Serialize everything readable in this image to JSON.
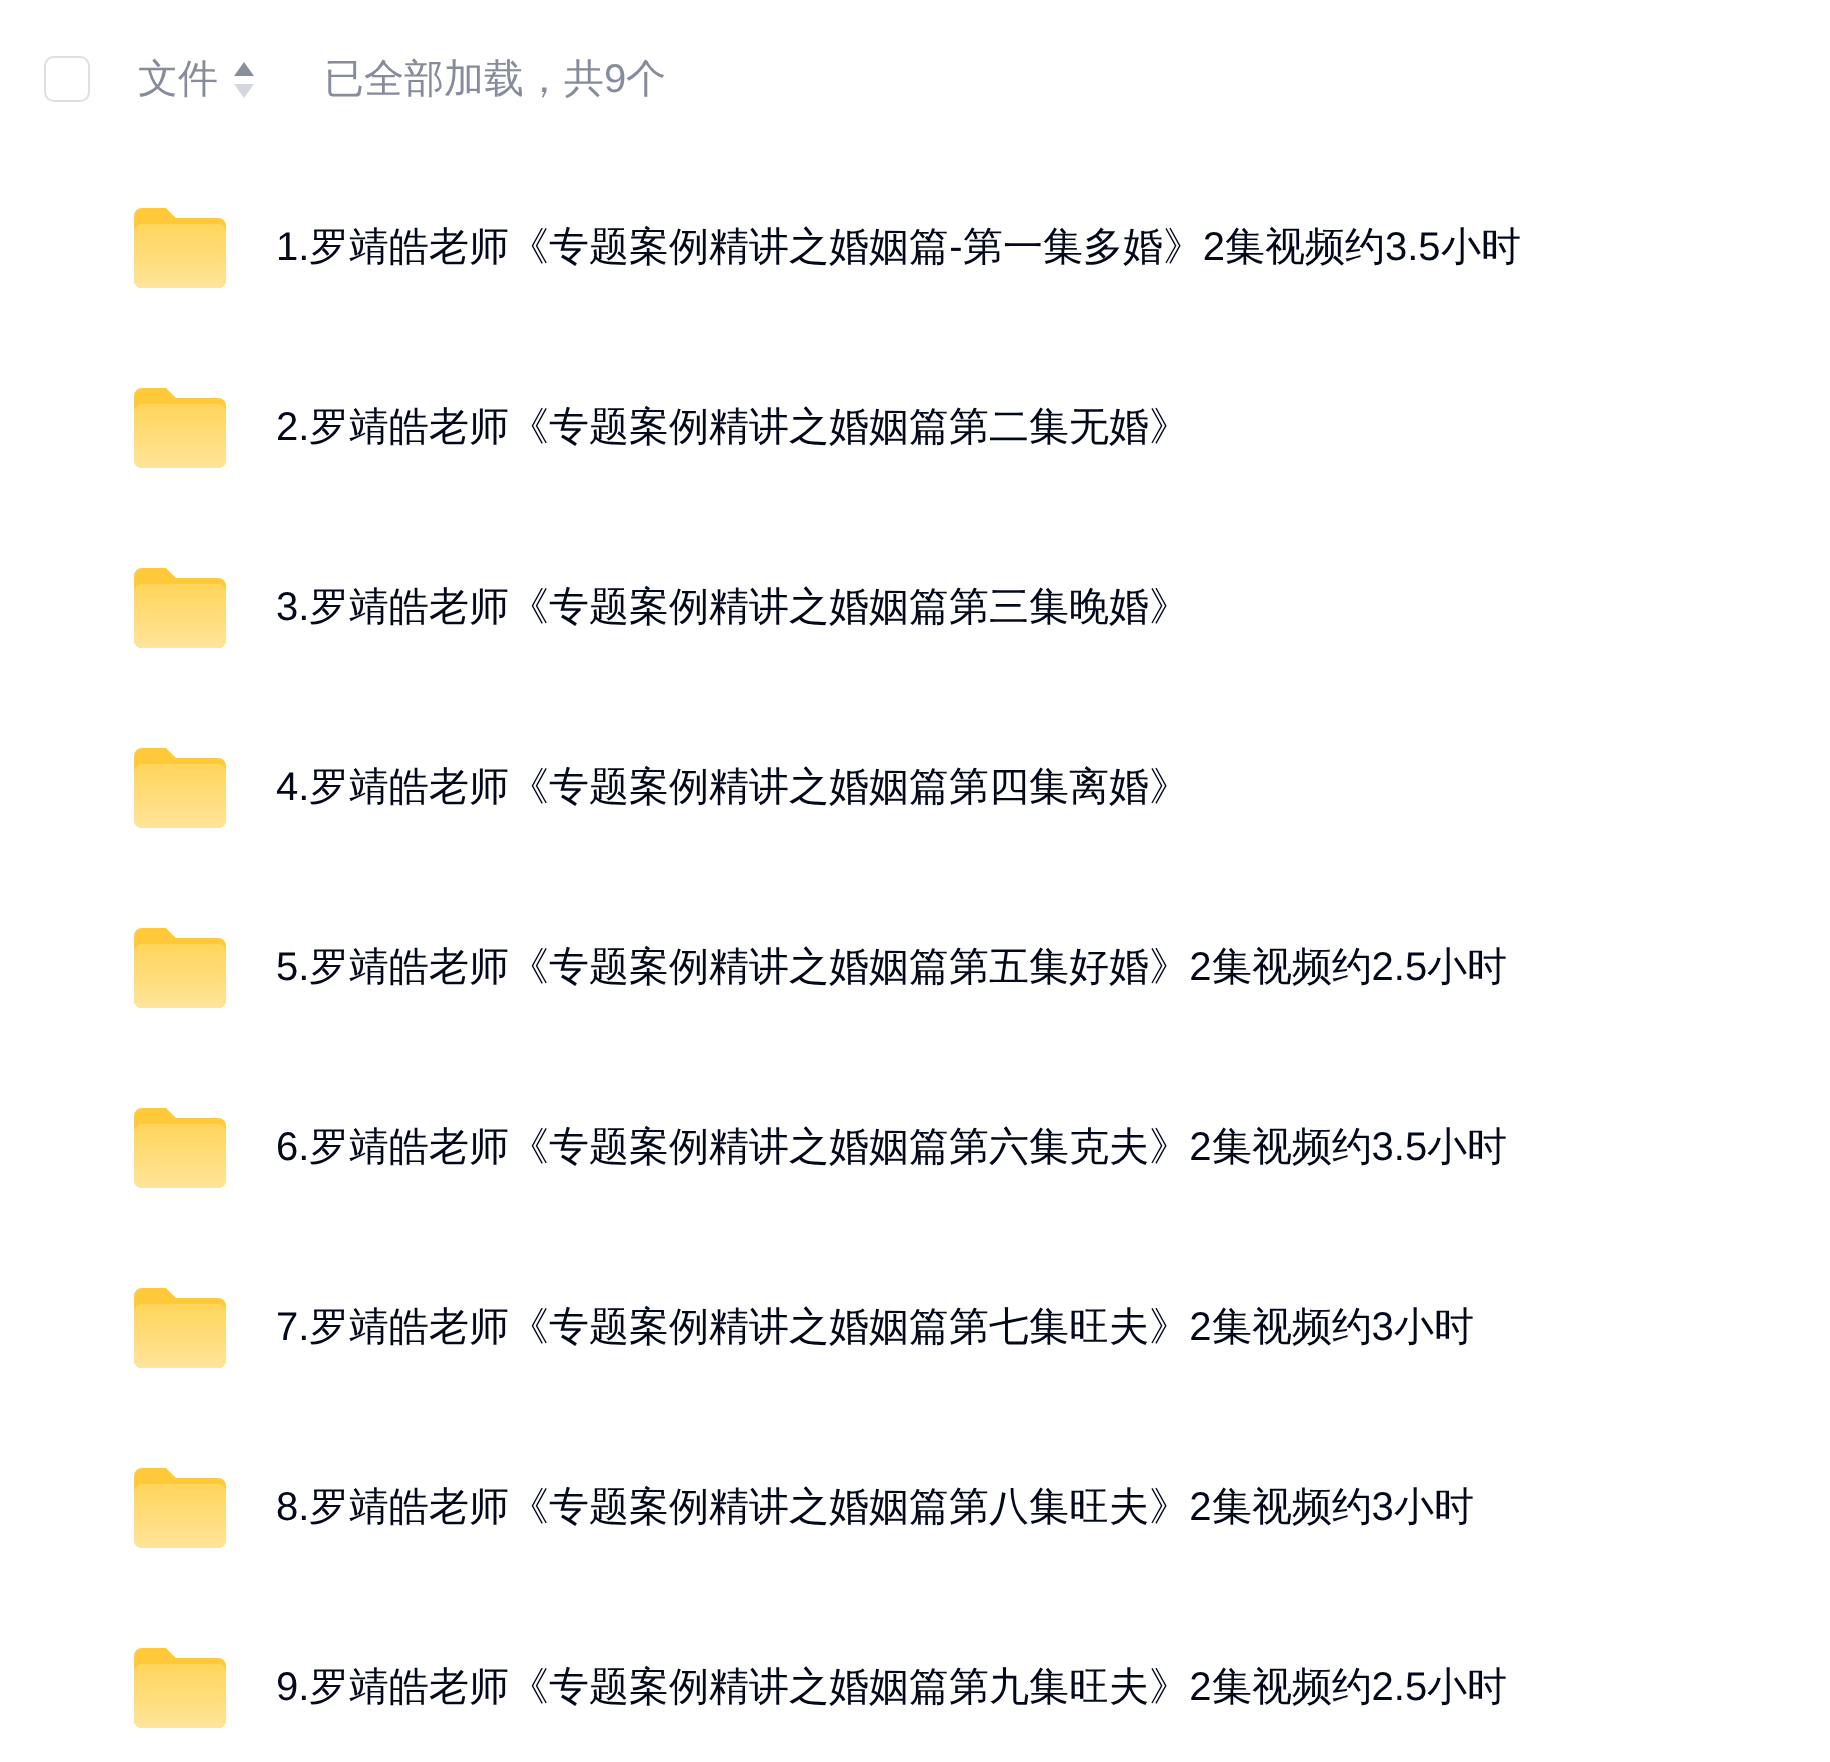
{
  "header": {
    "select_all": {
      "checked": false
    },
    "column_label": "文件",
    "status": "已全部加载，共9个"
  },
  "files": [
    {
      "name": "1.罗靖皓老师《专题案例精讲之婚姻篇-第一集多婚》2集视频约3.5小时"
    },
    {
      "name": "2.罗靖皓老师《专题案例精讲之婚姻篇第二集无婚》"
    },
    {
      "name": "3.罗靖皓老师《专题案例精讲之婚姻篇第三集晚婚》"
    },
    {
      "name": "4.罗靖皓老师《专题案例精讲之婚姻篇第四集离婚》"
    },
    {
      "name": "5.罗靖皓老师《专题案例精讲之婚姻篇第五集好婚》2集视频约2.5小时"
    },
    {
      "name": "6.罗靖皓老师《专题案例精讲之婚姻篇第六集克夫》2集视频约3.5小时"
    },
    {
      "name": "7.罗靖皓老师《专题案例精讲之婚姻篇第七集旺夫》2集视频约3小时"
    },
    {
      "name": "8.罗靖皓老师《专题案例精讲之婚姻篇第八集旺夫》2集视频约3小时"
    },
    {
      "name": "9.罗靖皓老师《专题案例精讲之婚姻篇第九集旺夫》2集视频约2.5小时"
    }
  ]
}
